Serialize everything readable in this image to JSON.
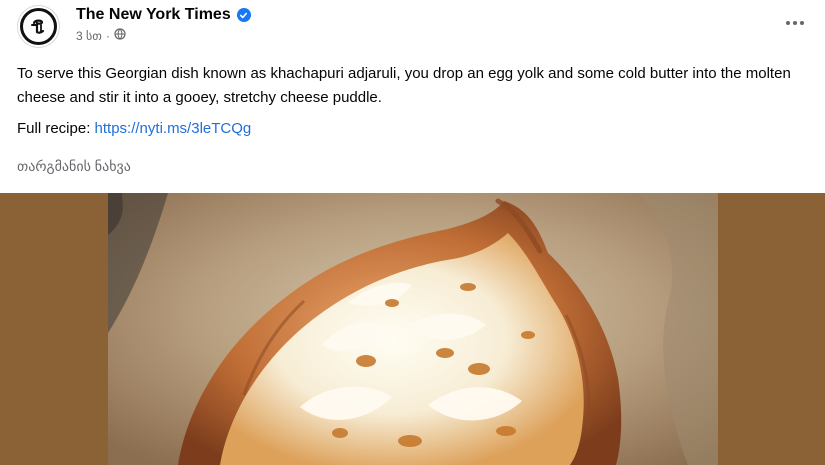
{
  "post": {
    "page_name": "The New York Times",
    "time": "3 სთ",
    "separator": "·",
    "text": "To serve this Georgian dish known as khachapuri adjaruli, you drop an egg yolk and some cold butter into the molten cheese and stir it into a gooey, stretchy cheese puddle.",
    "recipe_label": "Full recipe:",
    "recipe_link": "https://nyti.ms/3leTCQg",
    "translate_label": "თარგმანის ნახვა"
  },
  "icons": {
    "avatar": "nyt-logo-icon",
    "verified": "verified-badge-icon",
    "privacy": "globe-icon",
    "more": "more-options-icon"
  },
  "colors": {
    "link": "#216fdb",
    "verified": "#1877f2",
    "secondary_text": "#65676b",
    "photo_background": "#8a6236"
  }
}
